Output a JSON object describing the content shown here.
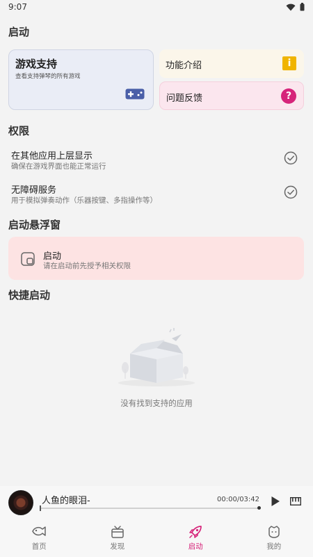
{
  "status_bar": {
    "time": "9:07"
  },
  "sections": {
    "launch": "启动",
    "permissions": "权限",
    "floating_window": "启动悬浮窗",
    "quick_launch": "快捷启动"
  },
  "game_support": {
    "title": "游戏支持",
    "subtitle": "查看支持弹琴的所有游戏"
  },
  "feature_intro": {
    "label": "功能介绍",
    "badge": "i"
  },
  "feedback": {
    "label": "问题反馈",
    "badge": "?"
  },
  "permissions": [
    {
      "title": "在其他应用上层显示",
      "subtitle": "确保在游戏界面也能正常运行"
    },
    {
      "title": "无障碍服务",
      "subtitle": "用于模拟弹奏动作（乐器按键、多指操作等）"
    }
  ],
  "float_card": {
    "title": "启动",
    "subtitle": "请在启动前先授予相关权限"
  },
  "empty_state": {
    "text": "没有找到支持的应用"
  },
  "player": {
    "song_title": "人鱼的眼泪-",
    "time": "00:00/03:42",
    "progress": 0
  },
  "nav": [
    {
      "label": "首页"
    },
    {
      "label": "发现"
    },
    {
      "label": "启动"
    },
    {
      "label": "我的"
    }
  ],
  "colors": {
    "accent": "#d6247a",
    "info": "#f0b400",
    "game_card": "#eaedf6"
  }
}
